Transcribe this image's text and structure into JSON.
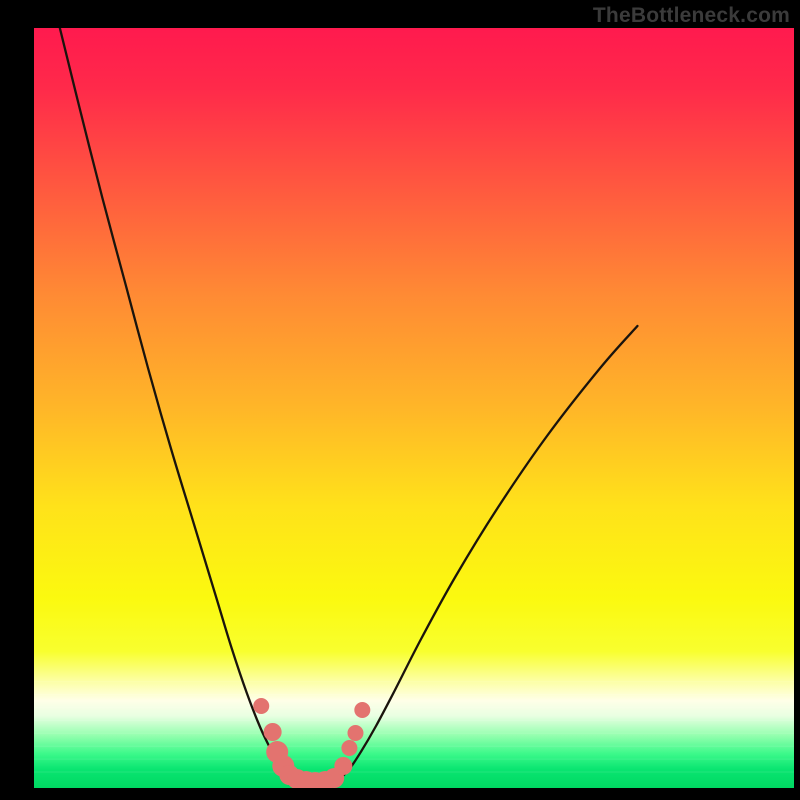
{
  "watermark": "TheBottleneck.com",
  "gradient_stops": [
    {
      "offset": 0.0,
      "color": "#ff1a4e"
    },
    {
      "offset": 0.08,
      "color": "#ff2a4a"
    },
    {
      "offset": 0.2,
      "color": "#ff5540"
    },
    {
      "offset": 0.35,
      "color": "#ff8a34"
    },
    {
      "offset": 0.5,
      "color": "#ffb628"
    },
    {
      "offset": 0.63,
      "color": "#ffe21a"
    },
    {
      "offset": 0.75,
      "color": "#fbf90f"
    },
    {
      "offset": 0.82,
      "color": "#f8ff2e"
    },
    {
      "offset": 0.86,
      "color": "#fcffa6"
    },
    {
      "offset": 0.885,
      "color": "#ffffe8"
    },
    {
      "offset": 0.905,
      "color": "#e9ffe2"
    },
    {
      "offset": 0.93,
      "color": "#97ffb0"
    },
    {
      "offset": 0.955,
      "color": "#3cf98a"
    },
    {
      "offset": 0.975,
      "color": "#0ae571"
    },
    {
      "offset": 1.0,
      "color": "#00d862"
    }
  ],
  "chart_data": {
    "type": "line",
    "title": "",
    "xlabel": "",
    "ylabel": "",
    "xlim": [
      0,
      1000
    ],
    "ylim": [
      0,
      760
    ],
    "series": [
      {
        "name": "left-curve",
        "x": [
          34,
          60,
          90,
          120,
          150,
          180,
          210,
          240,
          260,
          280,
          298,
          314,
          326,
          336
        ],
        "y": [
          760,
          680,
          590,
          505,
          420,
          340,
          265,
          190,
          140,
          95,
          60,
          35,
          18,
          8
        ]
      },
      {
        "name": "right-curve",
        "x": [
          400,
          414,
          430,
          450,
          475,
          510,
          555,
          610,
          675,
          745,
          794
        ],
        "y": [
          8,
          18,
          36,
          62,
          98,
          150,
          212,
          280,
          352,
          420,
          462
        ]
      },
      {
        "name": "valley-flat",
        "x": [
          336,
          350,
          368,
          384,
          400
        ],
        "y": [
          8,
          4,
          3,
          4,
          8
        ]
      }
    ],
    "markers_left": [
      {
        "x": 299,
        "y": 82,
        "r": 8
      },
      {
        "x": 314,
        "y": 56,
        "r": 9
      },
      {
        "x": 320,
        "y": 36,
        "r": 11
      },
      {
        "x": 328,
        "y": 22,
        "r": 11
      },
      {
        "x": 336,
        "y": 13,
        "r": 10
      },
      {
        "x": 346,
        "y": 9,
        "r": 10
      },
      {
        "x": 358,
        "y": 7,
        "r": 10
      },
      {
        "x": 370,
        "y": 6,
        "r": 10
      },
      {
        "x": 383,
        "y": 7,
        "r": 10
      },
      {
        "x": 395,
        "y": 10,
        "r": 10
      }
    ],
    "markers_right": [
      {
        "x": 407,
        "y": 22,
        "r": 9
      },
      {
        "x": 415,
        "y": 40,
        "r": 8
      },
      {
        "x": 423,
        "y": 55,
        "r": 8
      },
      {
        "x": 432,
        "y": 78,
        "r": 8
      }
    ],
    "marker_color": "#e3736f",
    "curve_stroke": "#1a140d",
    "curve_width": 2.3
  }
}
